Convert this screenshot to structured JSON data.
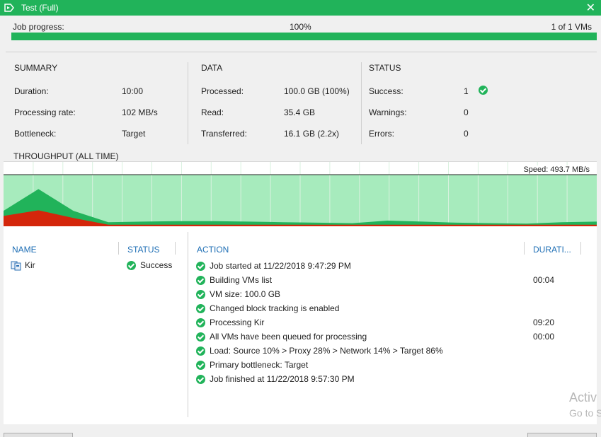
{
  "window": {
    "title": "Test (Full)"
  },
  "progress": {
    "label": "Job progress:",
    "percent_text": "100%",
    "percent": 100,
    "vms_text": "1 of 1 VMs"
  },
  "summary": {
    "title": "SUMMARY",
    "items": [
      {
        "label": "Duration:",
        "value": "10:00"
      },
      {
        "label": "Processing rate:",
        "value": "102 MB/s"
      },
      {
        "label": "Bottleneck:",
        "value": "Target"
      }
    ]
  },
  "data_section": {
    "title": "DATA",
    "items": [
      {
        "label": "Processed:",
        "value": "100.0 GB (100%)"
      },
      {
        "label": "Read:",
        "value": "35.4 GB"
      },
      {
        "label": "Transferred:",
        "value": "16.1 GB (2.2x)"
      }
    ]
  },
  "status_section": {
    "title": "STATUS",
    "items": [
      {
        "label": "Success:",
        "value": "1"
      },
      {
        "label": "Warnings:",
        "value": "0"
      },
      {
        "label": "Errors:",
        "value": "0"
      }
    ]
  },
  "throughput": {
    "title": "THROUGHPUT (ALL TIME)",
    "speed_text": "Speed: 493.7 MB/s"
  },
  "chart_data": {
    "type": "area",
    "x": [
      0,
      1,
      2,
      3,
      4,
      5,
      6,
      7,
      8,
      9,
      10,
      11,
      12,
      13,
      14,
      15,
      16,
      17
    ],
    "series": [
      {
        "values": [
          30,
          72,
          30,
          8,
          9,
          10,
          10,
          9,
          8,
          7,
          6,
          11,
          9,
          7,
          6,
          5,
          8,
          9
        ],
        "color": "#21b35a"
      },
      {
        "values": [
          20,
          31,
          16,
          3,
          3,
          3,
          3,
          3,
          3,
          3,
          3,
          3,
          3,
          3,
          3,
          3,
          3,
          3
        ],
        "color": "#d4260b"
      }
    ],
    "ylim": [
      0,
      100
    ],
    "background": "#a7ebbd",
    "grid": true
  },
  "vm_table": {
    "headers": {
      "name": "NAME",
      "status": "STATUS"
    },
    "rows": [
      {
        "name": "Kir",
        "status": "Success"
      }
    ]
  },
  "action_table": {
    "headers": {
      "action": "ACTION",
      "duration": "DURATI..."
    },
    "rows": [
      {
        "action": "Job started at 11/22/2018 9:47:29 PM",
        "duration": ""
      },
      {
        "action": "Building VMs list",
        "duration": "00:04"
      },
      {
        "action": "VM size: 100.0 GB",
        "duration": ""
      },
      {
        "action": "Changed block tracking is enabled",
        "duration": ""
      },
      {
        "action": "Processing Kir",
        "duration": "09:20"
      },
      {
        "action": "All VMs have been queued for processing",
        "duration": "00:00"
      },
      {
        "action": "Load: Source 10% > Proxy 28% > Network 14% > Target 86%",
        "duration": ""
      },
      {
        "action": "Primary bottleneck: Target",
        "duration": ""
      },
      {
        "action": "Job finished at 11/22/2018 9:57:30 PM",
        "duration": ""
      }
    ]
  },
  "watermark": {
    "line1": "Activ",
    "line2": "Go to S"
  },
  "colors": {
    "accent": "#21b35a",
    "link": "#1f6fb5",
    "red": "#d4260b"
  }
}
